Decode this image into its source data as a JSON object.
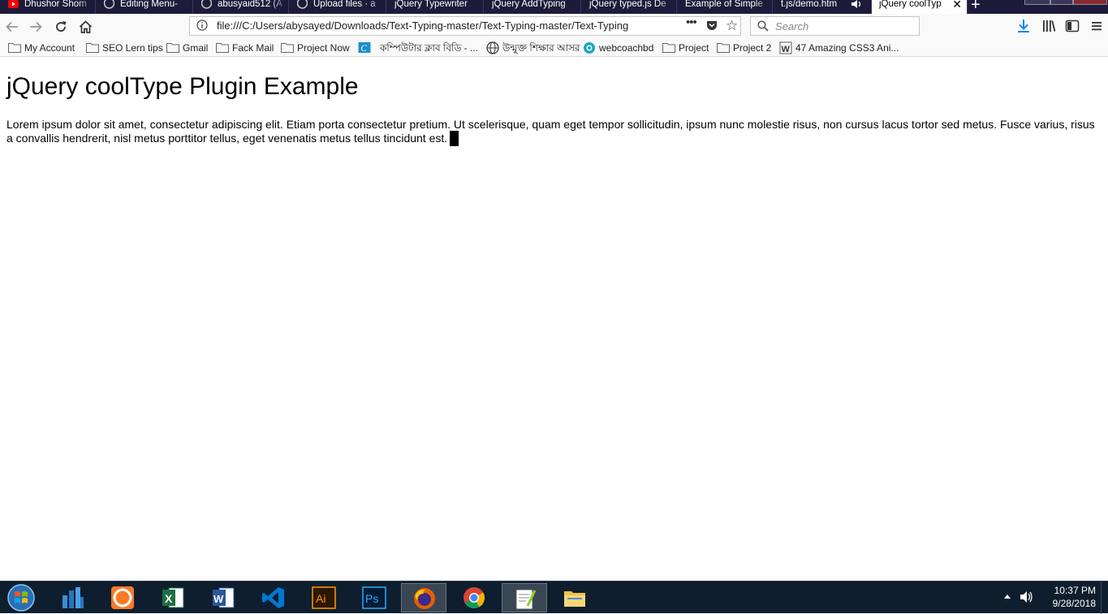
{
  "browser": {
    "tabs": [
      {
        "title": "Dhushor Shom",
        "icon": "youtube-icon"
      },
      {
        "title": "Editing Menu-",
        "icon": "github-icon"
      },
      {
        "title": "abusyaid512 (A",
        "icon": "github-icon"
      },
      {
        "title": "Upload files · a",
        "icon": "github-icon"
      },
      {
        "title": "jQuery Typewriter",
        "icon": "page-icon"
      },
      {
        "title": "jQuery AddTyping",
        "icon": "page-icon"
      },
      {
        "title": "jQuery typed.js De",
        "icon": "page-icon"
      },
      {
        "title": "Example of Simple",
        "icon": "page-icon"
      },
      {
        "title": "t.js/demo.htm",
        "icon": "speaker-icon"
      },
      {
        "title": "jQuery coolTyp",
        "icon": "page-icon",
        "active": true
      }
    ],
    "url": "file:///C:/Users/abysayed/Downloads/Text-Typing-master/Text-Typing-master/Text-Typing",
    "search_placeholder": "Search",
    "bookmarks": [
      {
        "label": "My Account",
        "icon": "folder-icon"
      },
      {
        "label": "SEO Lern tips",
        "icon": "folder-icon"
      },
      {
        "label": "Gmail",
        "icon": "folder-icon"
      },
      {
        "label": "Fack Mail",
        "icon": "folder-icon"
      },
      {
        "label": "Project Now",
        "icon": "folder-icon"
      },
      {
        "label": "কম্পিউটার ক্লাব বিডি - ...",
        "icon": "site-icon"
      },
      {
        "label": "উন্মুক্ত শিক্ষার আসর",
        "icon": "globe-icon"
      },
      {
        "label": "webcoachbd",
        "icon": "webcoach-icon"
      },
      {
        "label": "Project",
        "icon": "folder-icon"
      },
      {
        "label": "Project 2",
        "icon": "folder-icon"
      },
      {
        "label": "47 Amazing CSS3 Ani...",
        "icon": "word-doc-icon"
      }
    ]
  },
  "page": {
    "heading": "jQuery coolType Plugin Example",
    "paragraph": "Lorem ipsum dolor sit amet, consectetur adipiscing elit. Etiam porta consectetur pretium. Ut scelerisque, quam eget tempor sollicitudin, ipsum nunc molestie risus, non cursus lacus tortor sed metus. Fusce varius, risus a convallis hendrerit, nisl metus porttitor tellus, eget venenatis metus tellus tincidunt est."
  },
  "taskbar": {
    "apps": [
      "network-app-icon",
      "xampp-icon",
      "excel-icon",
      "word-icon",
      "vscode-icon",
      "illustrator-icon",
      "photoshop-icon",
      "firefox-icon",
      "chrome-icon",
      "notepad-plus-plus-icon",
      "file-explorer-icon"
    ],
    "time": "10:37 PM",
    "date": "9/28/2018"
  },
  "colors": {
    "tabbar": "#1e1b3a",
    "taskbar": "#0e1e2e",
    "download_blue": "#0a84ff"
  }
}
